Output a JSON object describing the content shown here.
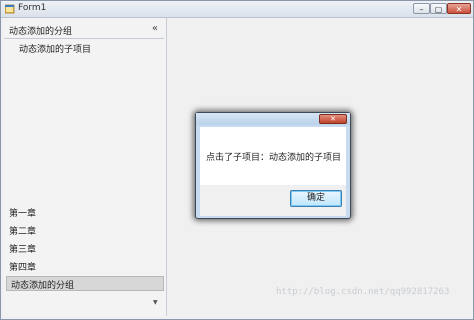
{
  "window": {
    "title": "Form1",
    "minimize_glyph": "–",
    "maximize_glyph": "▢",
    "close_glyph": "✕"
  },
  "sidebar": {
    "group_header": "动态添加的分组",
    "collapse_glyph": "«",
    "sub_items": [
      "动态添加的子项目"
    ],
    "nav_items": [
      "第一章",
      "第二章",
      "第三章",
      "第四章"
    ],
    "selected_item": "动态添加的分组",
    "scroll_glyph": "▼"
  },
  "watermark": "http://blog.csdn.net/qq992817263",
  "dialog": {
    "message": "点击了子项目：动态添加的子项目",
    "ok_label": "确定",
    "close_glyph": "✕"
  }
}
